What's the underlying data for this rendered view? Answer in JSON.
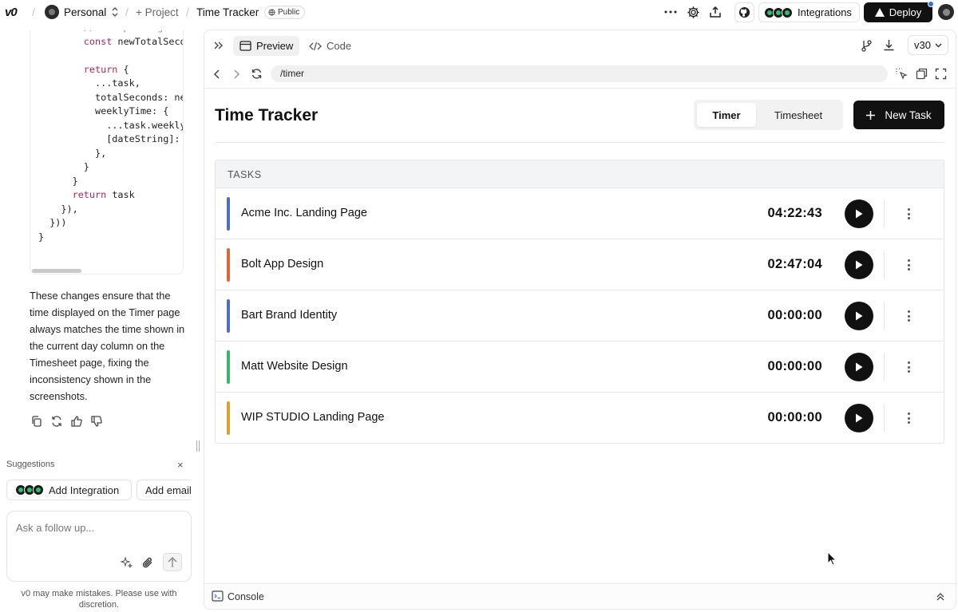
{
  "topbar": {
    "logo": "v0",
    "workspace": "Personal",
    "project_link": "+ Project",
    "title": "Time Tracker",
    "visibility": "Public",
    "integrations": "Integrations",
    "deploy": "Deploy"
  },
  "code": {
    "lines": [
      {
        "text": "// If updating tod",
        "cls": "cm",
        "indent": 6
      },
      {
        "text": "const newTotalSeco",
        "cls": "kw-const",
        "indent": 6
      },
      {
        "text": "",
        "indent": 0
      },
      {
        "text": "return {",
        "cls": "kw-return",
        "indent": 6
      },
      {
        "text": "...task,",
        "indent": 8
      },
      {
        "text": "totalSeconds: ne",
        "indent": 8
      },
      {
        "text": "weeklyTime: {",
        "indent": 8
      },
      {
        "text": "...task.weekly",
        "indent": 10
      },
      {
        "text": "[dateString]:",
        "indent": 10
      },
      {
        "text": "},",
        "indent": 8
      },
      {
        "text": "}",
        "indent": 6
      },
      {
        "text": "}",
        "indent": 4
      },
      {
        "text": "return task",
        "cls": "kw-return",
        "indent": 4
      },
      {
        "text": "}),",
        "indent": 2
      },
      {
        "text": "}))",
        "indent": 0
      },
      {
        "text": "}",
        "indent": -2
      }
    ]
  },
  "message": "These changes ensure that the time displayed on the Timer page always matches the time shown in the current day column on the Timesheet page, fixing the inconsistency shown in the screenshots.",
  "suggestions": {
    "label": "Suggestions",
    "close": "×",
    "chips": [
      "Add Integration",
      "Add email"
    ]
  },
  "composer": {
    "placeholder": "Ask a follow up...",
    "disclaimer": "v0 may make mistakes. Please use with discretion."
  },
  "preview": {
    "tabs": [
      "Preview",
      "Code"
    ],
    "version": "v30",
    "url": "/timer",
    "console": "Console"
  },
  "app": {
    "title": "Time Tracker",
    "segments": [
      "Timer",
      "Timesheet"
    ],
    "active_segment": "Timer",
    "new_task": "New Task",
    "tasks_header": "TASKS",
    "tasks": [
      {
        "name": "Acme Inc. Landing Page",
        "time": "04:22:43",
        "color": "#4a6fc7"
      },
      {
        "name": "Bolt App Design",
        "time": "02:47:04",
        "color": "#e0663a"
      },
      {
        "name": "Bart Brand Identity",
        "time": "00:00:00",
        "color": "#4a6fc7"
      },
      {
        "name": "Matt Website Design",
        "time": "00:00:00",
        "color": "#3fb36a"
      },
      {
        "name": "WIP STUDIO Landing Page",
        "time": "00:00:00",
        "color": "#e0a12a"
      }
    ]
  }
}
